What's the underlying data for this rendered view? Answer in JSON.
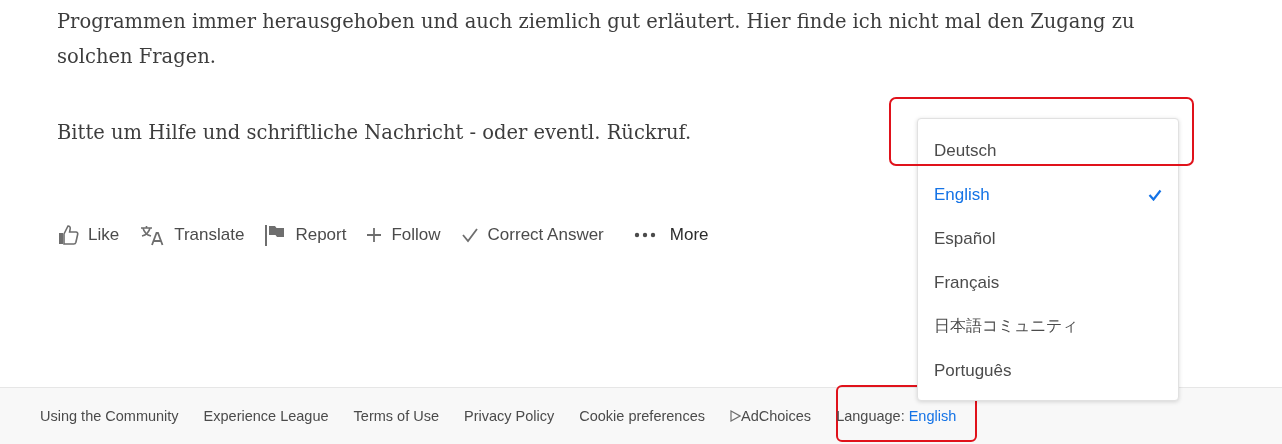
{
  "post": {
    "paragraphs": [
      "Programmen immer herausgehoben und auch ziemlich gut erläutert. Hier finde ich nicht mal den Zugang zu solchen Fragen.",
      "Bitte um Hilfe und schriftliche Nachricht - oder eventl. Rückruf."
    ]
  },
  "actions": [
    {
      "kind": "like",
      "label": "Like"
    },
    {
      "kind": "translate",
      "label": "Translate"
    },
    {
      "kind": "report",
      "label": "Report"
    },
    {
      "kind": "follow",
      "label": "Follow"
    },
    {
      "kind": "correct",
      "label": "Correct Answer"
    },
    {
      "kind": "more",
      "label": "More"
    }
  ],
  "language_menu": {
    "items": [
      {
        "label": "Deutsch",
        "selected": false,
        "highlighted": true
      },
      {
        "label": "English",
        "selected": true,
        "highlighted": false
      },
      {
        "label": "Español",
        "selected": false,
        "highlighted": false
      },
      {
        "label": "Français",
        "selected": false,
        "highlighted": false
      },
      {
        "label": "日本語コミュニティ",
        "selected": false,
        "highlighted": false
      },
      {
        "label": "Português",
        "selected": false,
        "highlighted": false
      }
    ]
  },
  "footer": {
    "links": [
      {
        "kind": "text",
        "label": "Using the Community"
      },
      {
        "kind": "text",
        "label": "Experience League"
      },
      {
        "kind": "text",
        "label": "Terms of Use"
      },
      {
        "kind": "text",
        "label": "Privacy Policy"
      },
      {
        "kind": "text",
        "label": "Cookie preferences"
      },
      {
        "kind": "adchoices",
        "label": "AdChoices"
      }
    ],
    "language": {
      "label": "Language:",
      "value": "English",
      "highlighted": true
    }
  }
}
